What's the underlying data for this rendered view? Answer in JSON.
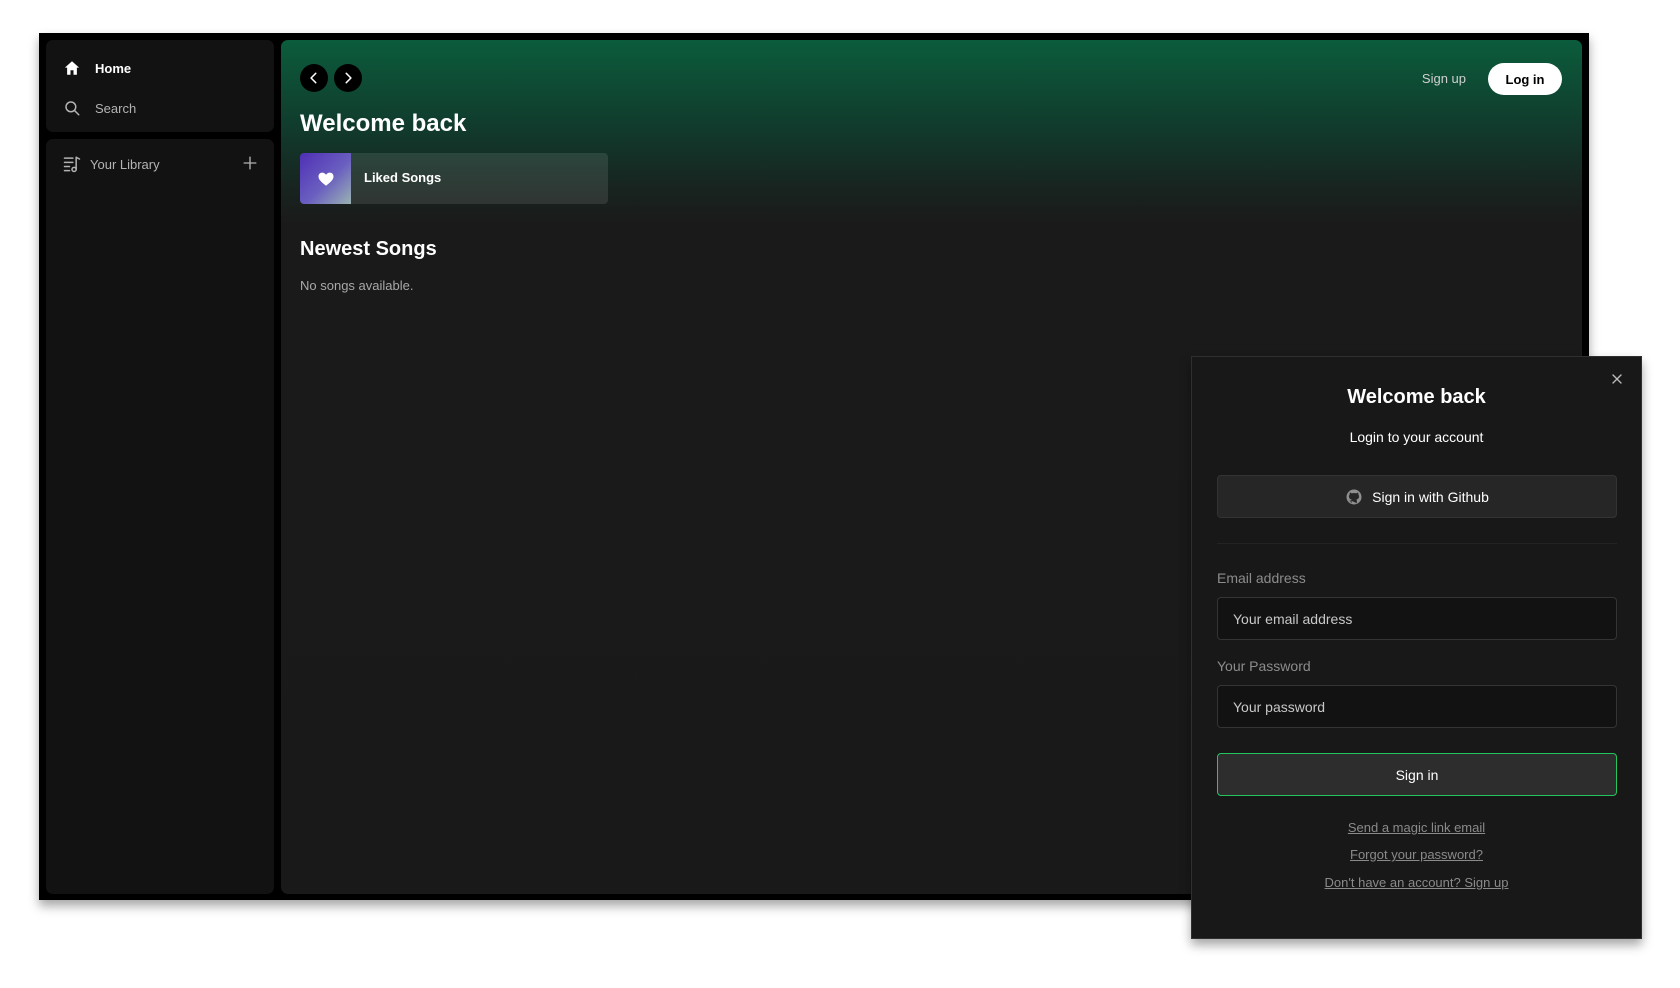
{
  "sidebar": {
    "nav": {
      "home_label": "Home",
      "home_icon": "home-icon",
      "search_label": "Search",
      "search_icon": "search-icon"
    },
    "library": {
      "title": "Your Library",
      "icon": "library-icon",
      "add_icon": "plus-icon"
    }
  },
  "header": {
    "back_icon": "chevron-left-icon",
    "forward_icon": "chevron-right-icon",
    "signup_label": "Sign up",
    "login_label": "Log in"
  },
  "main": {
    "title": "Welcome back",
    "liked": {
      "label": "Liked Songs",
      "icon": "heart-icon",
      "gradient_colors": [
        "#4f2fb5",
        "#9ab3b2"
      ]
    },
    "section_title": "Newest Songs",
    "empty_message": "No songs available.",
    "gradient_color": "#0b5c3c"
  },
  "auth_modal": {
    "close_icon": "close-icon",
    "title": "Welcome back",
    "subtitle": "Login to your account",
    "github_label": "Sign in with Github",
    "github_icon": "github-icon",
    "email_label": "Email address",
    "email_placeholder": "Your email address",
    "email_value": "",
    "password_label": "Your Password",
    "password_placeholder": "Your password",
    "password_value": "",
    "submit_label": "Sign in",
    "accent_color": "#22c55e",
    "links": {
      "magic_link": "Send a magic link email",
      "forgot_password": "Forgot your password?",
      "signup": "Don't have an account? Sign up"
    }
  }
}
